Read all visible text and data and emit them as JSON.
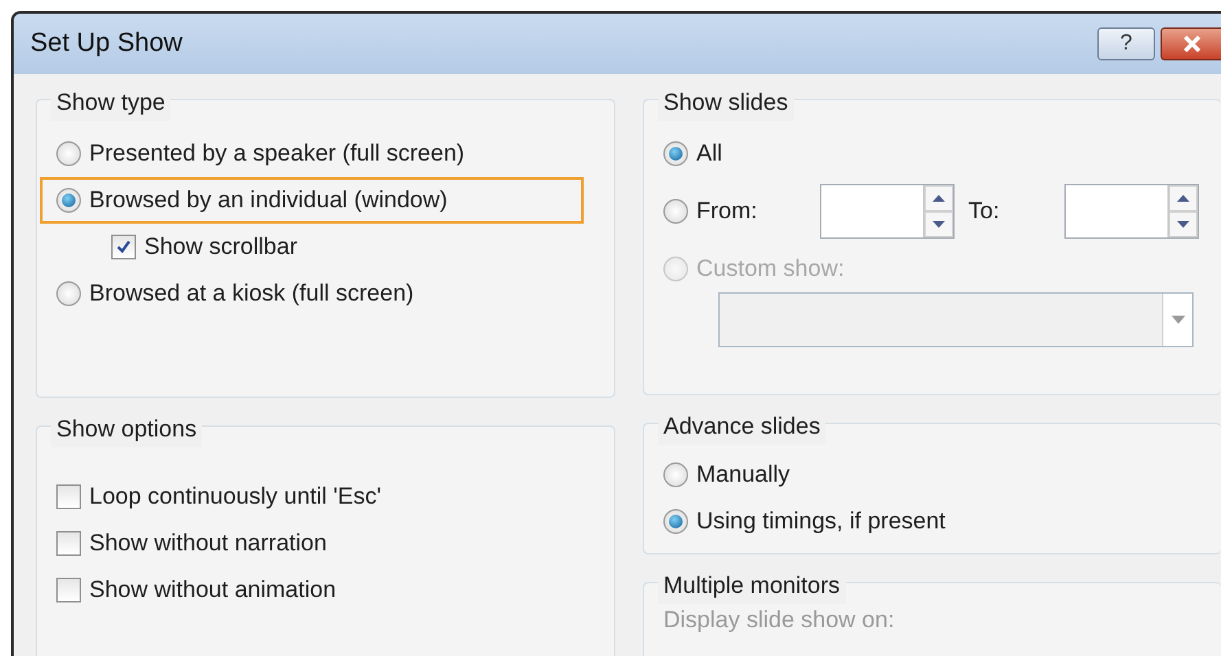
{
  "window": {
    "title": "Set Up Show",
    "help_button": "?"
  },
  "show_type": {
    "title": "Show type",
    "options": [
      {
        "label": "Presented by a speaker (full screen)",
        "selected": false,
        "highlighted": false
      },
      {
        "label": "Browsed by an individual (window)",
        "selected": true,
        "highlighted": true,
        "sub_option": {
          "label": "Show scrollbar",
          "checked": true
        }
      },
      {
        "label": "Browsed at a kiosk (full screen)",
        "selected": false,
        "highlighted": false
      }
    ]
  },
  "show_slides": {
    "title": "Show slides",
    "options": [
      {
        "kind": "plain",
        "label": "All",
        "selected": true,
        "disabled": false
      },
      {
        "kind": "range",
        "label": "From:",
        "selected": false,
        "disabled": false,
        "to_label": "To:"
      },
      {
        "kind": "custom",
        "label": "Custom show:",
        "selected": false,
        "disabled": true
      }
    ]
  },
  "show_options": {
    "title": "Show options",
    "checkboxes": [
      {
        "label": "Loop continuously until 'Esc'",
        "checked": false
      },
      {
        "label": "Show without narration",
        "checked": false
      },
      {
        "label": "Show without animation",
        "checked": false
      }
    ]
  },
  "advance_slides": {
    "title": "Advance slides",
    "options": [
      {
        "label": "Manually",
        "selected": false
      },
      {
        "label": "Using timings, if present",
        "selected": true
      }
    ]
  },
  "multiple_monitors": {
    "title": "Multiple monitors",
    "label": "Display slide show on:",
    "disabled": true
  }
}
